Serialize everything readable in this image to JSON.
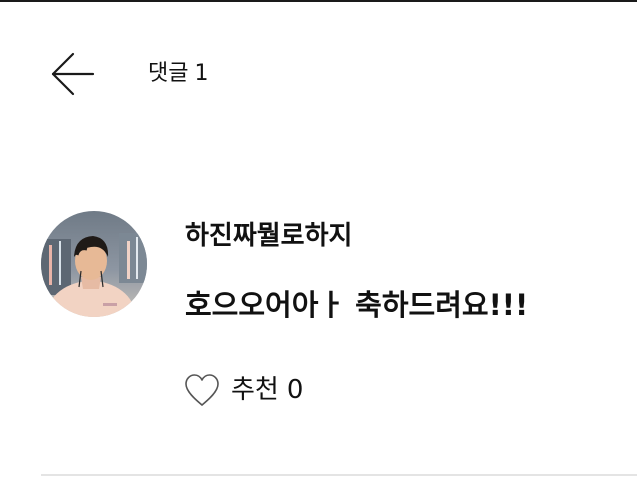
{
  "header": {
    "title": "댓글",
    "comment_count": "1",
    "back_icon": "arrow-left-icon"
  },
  "comment": {
    "username": "하진짜뭘로하지",
    "text": "호으오어아ㅏ 축하드려요!!!",
    "like_label": "추천",
    "like_count": "0",
    "like_icon": "heart-outline-icon"
  },
  "colors": {
    "text": "#111111",
    "border_top": "#1a1a1a",
    "divider": "#e4e4e4",
    "icon_stroke": "#1a1a1a",
    "heart_stroke": "#555555"
  }
}
